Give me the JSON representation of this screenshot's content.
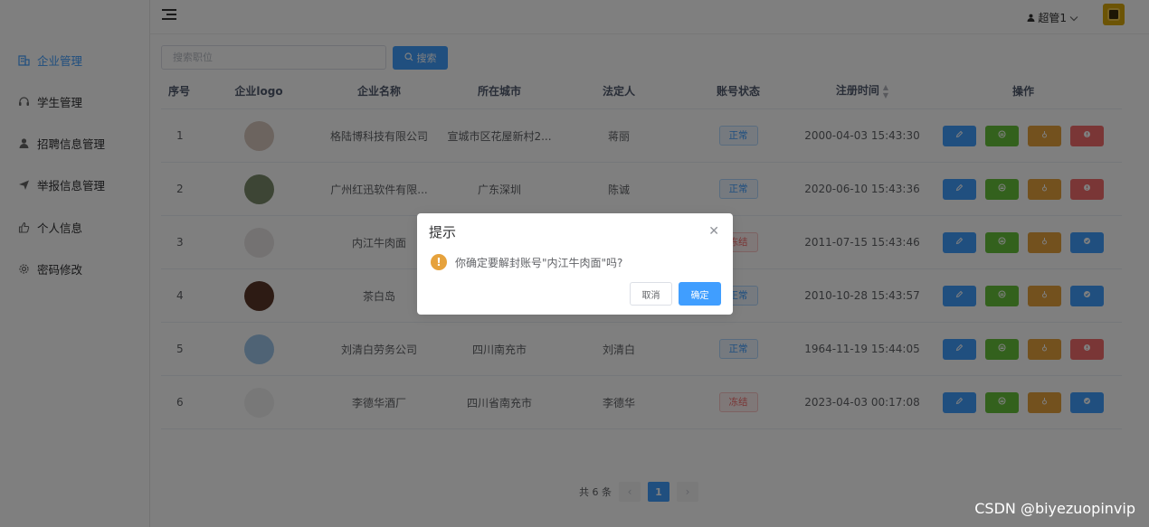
{
  "sidebar": {
    "items": [
      {
        "label": "企业管理",
        "icon": "building-icon",
        "active": true
      },
      {
        "label": "学生管理",
        "icon": "headset-icon",
        "active": false
      },
      {
        "label": "招聘信息管理",
        "icon": "user-icon",
        "active": false
      },
      {
        "label": "举报信息管理",
        "icon": "send-icon",
        "active": false
      },
      {
        "label": "个人信息",
        "icon": "thumb-icon",
        "active": false
      },
      {
        "label": "密码修改",
        "icon": "gear-icon",
        "active": false
      }
    ]
  },
  "header": {
    "user_name": "超管1"
  },
  "search": {
    "placeholder": "搜索职位",
    "button_label": "搜索"
  },
  "table": {
    "columns": [
      "序号",
      "企业logo",
      "企业名称",
      "所在城市",
      "法定人",
      "账号状态",
      "注册时间",
      "操作"
    ],
    "rows": [
      {
        "index": "1",
        "name": "格陆博科技有限公司",
        "city": "宣城市区花屋新村2...",
        "legal": "蒋丽",
        "status": "正常",
        "status_type": "normal",
        "time": "2000-04-03 15:43:30",
        "logo_color": "#d8c8bf",
        "last_op": "red"
      },
      {
        "index": "2",
        "name": "广州红迅软件有限...",
        "city": "广东深圳",
        "legal": "陈诚",
        "status": "正常",
        "status_type": "normal",
        "time": "2020-06-10 15:43:36",
        "logo_color": "#7a8a6a",
        "last_op": "red"
      },
      {
        "index": "3",
        "name": "内江牛肉面",
        "city": "",
        "legal": "",
        "status": "冻结",
        "status_type": "frozen",
        "time": "2011-07-15 15:43:46",
        "logo_color": "#e8e4e4",
        "last_op": "blue"
      },
      {
        "index": "4",
        "name": "茶白岛",
        "city": "",
        "legal": "",
        "status": "正常",
        "status_type": "normal",
        "time": "2010-10-28 15:43:57",
        "logo_color": "#5a3628",
        "last_op": "blue"
      },
      {
        "index": "5",
        "name": "刘清白劳务公司",
        "city": "四川南充市",
        "legal": "刘清白",
        "status": "正常",
        "status_type": "normal",
        "time": "1964-11-19 15:44:05",
        "logo_color": "#9ec7ea",
        "last_op": "red"
      },
      {
        "index": "6",
        "name": "李德华酒厂",
        "city": "四川省南充市",
        "legal": "李德华",
        "status": "冻结",
        "status_type": "frozen",
        "time": "2023-04-03 00:17:08",
        "logo_color": "#f0f0f0",
        "last_op": "blue"
      }
    ]
  },
  "pagination": {
    "total_label": "共 6 条",
    "current_page": "1"
  },
  "dialog": {
    "title": "提示",
    "message": "你确定要解封账号\"内江牛肉面\"吗?",
    "cancel_label": "取消",
    "confirm_label": "确定"
  },
  "watermark": "CSDN @biyezuopinvip",
  "colors": {
    "primary": "#409eff",
    "success": "#67c23a",
    "warning": "#e6a23c",
    "danger": "#f56c6c"
  }
}
